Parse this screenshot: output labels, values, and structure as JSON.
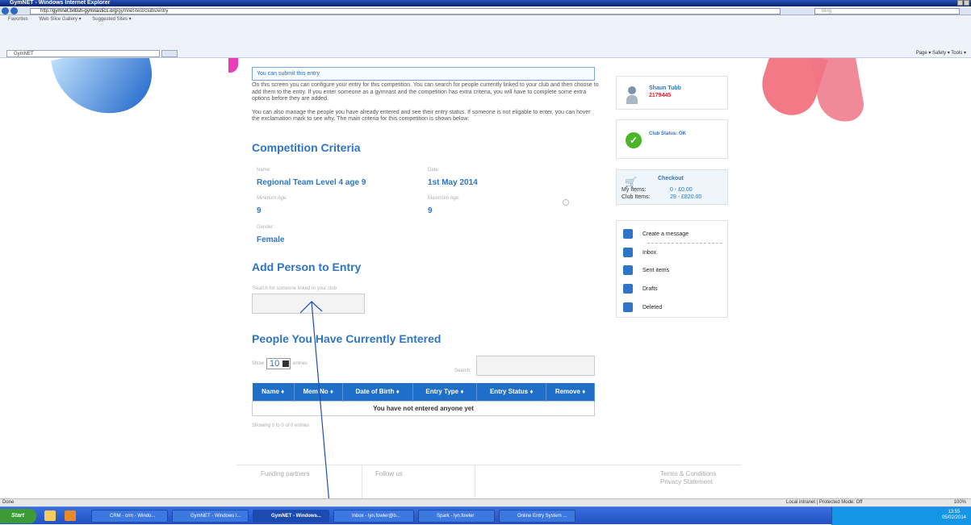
{
  "browser": {
    "title": "GymNET - Windows Internet Explorer",
    "url_prefix": "http://",
    "url_host": "gymnet.british-gymnastics.org",
    "url_path": "/gymnet-test/clubs/entry",
    "search_placeholder": "Bing",
    "favorites": [
      "Favorites",
      "Web Slice Gallery ▾",
      "Suggested Sites ▾"
    ],
    "tab_label": "GymNET",
    "command_bar": "Page ▾  Safety ▾  Tools ▾"
  },
  "notice": "You can submit this entry",
  "intro": {
    "p1": "On this screen you can configure your entry for this competition. You can search for people currently linked to your club and then choose to add them to the entry. If you enter someone as a gymnast and the competition has extra criteria, you will have to complete some extra options before they are added.",
    "p2": "You can also manage the people you have already entered and see their entry status. If someone is not eligable to enter, you can hover the exclamation mark to see why. The main criteria for this competition is shown below:"
  },
  "criteria": {
    "heading": "Competition Criteria",
    "name_label": "Name:",
    "name": "Regional Team Level 4 age 9",
    "date_label": "Date:",
    "date": "1st May 2014",
    "min_age_label": "Minimum Age:",
    "min_age": "9",
    "max_age_label": "Maximum Age:",
    "max_age": "9",
    "gender_label": "Gender:",
    "gender": "Female"
  },
  "add_person": {
    "heading": "Add Person to Entry",
    "search_label": "Search for someone linked to your club"
  },
  "entered": {
    "heading": "People You Have Currently Entered",
    "show_label": "Show",
    "show_value": "10",
    "entries_label": "entries",
    "search_label": "Search:",
    "columns": [
      "Name ♦",
      "Mem No ♦",
      "Date of Birth ♦",
      "Entry Type ♦",
      "Entry Status ♦",
      "Remove ♦"
    ],
    "empty_message": "You have not entered anyone yet",
    "showing": "Showing 0 to 0 of 0 entries"
  },
  "footer": {
    "funding": "Funding partners",
    "follow": "Follow us",
    "terms": "Terms & Conditions",
    "privacy": "Privacy Statement"
  },
  "sidebar": {
    "user_name": "Shaun Tubb",
    "user_id": "2179445",
    "club_status": "Club Status: OK",
    "checkout_title": "Checkout",
    "my_items_label": "My Items:",
    "my_items_value": "0  -  £0.00",
    "club_items_label": "Club Items:",
    "club_items_value": "29  -  £820.00",
    "messages": [
      "Create a message",
      "Inbox",
      "Sent items",
      "Drafts",
      "Deleted"
    ]
  },
  "statusbar": {
    "left": "Done",
    "zone": "Local intranet | Protected Mode: Off",
    "zoom": "100%"
  },
  "taskbar": {
    "start": "Start",
    "items": [
      "CRM - crm  - Windo...",
      "GymNET - Windows I...",
      "GymNET - Windows...",
      "Inbox - lyn.fowler@b...",
      "Spark - lyn.fowler",
      "Online Entry System ..."
    ],
    "time": "13:55",
    "date": "05/02/2014"
  }
}
